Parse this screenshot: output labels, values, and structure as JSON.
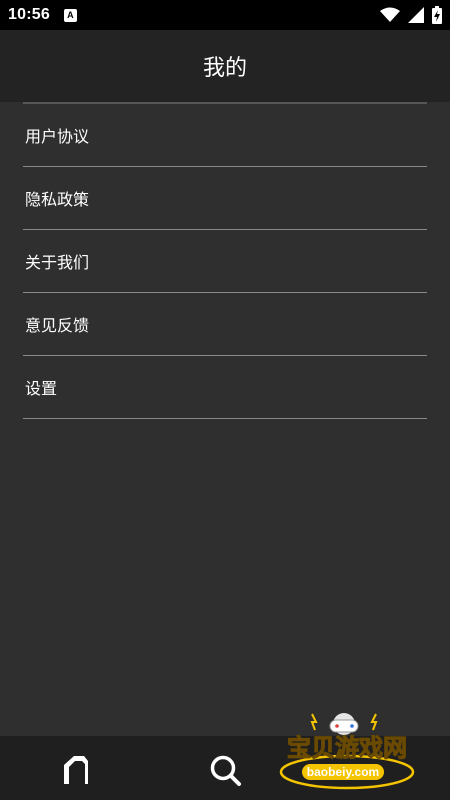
{
  "status_bar": {
    "time": "10:56",
    "notification_icon": "a-letter-icon",
    "icons": [
      "wifi-icon",
      "cell-signal-icon",
      "battery-charging-icon"
    ]
  },
  "header": {
    "title": "我的"
  },
  "menu": {
    "items": [
      {
        "label": "用户协议"
      },
      {
        "label": "隐私政策"
      },
      {
        "label": "关于我们"
      },
      {
        "label": "意见反馈"
      },
      {
        "label": "设置"
      }
    ]
  },
  "bottom_nav": {
    "items": [
      {
        "icon": "home-icon"
      },
      {
        "icon": "search-icon"
      }
    ]
  },
  "watermark": {
    "text": "宝贝游戏网",
    "url": "baobeiy.com"
  },
  "colors": {
    "background": "#2f2f2f",
    "header": "#232323",
    "status_bar": "#000000",
    "bottom_nav": "#1f1f1f",
    "watermark_gold": "#f5c400"
  }
}
